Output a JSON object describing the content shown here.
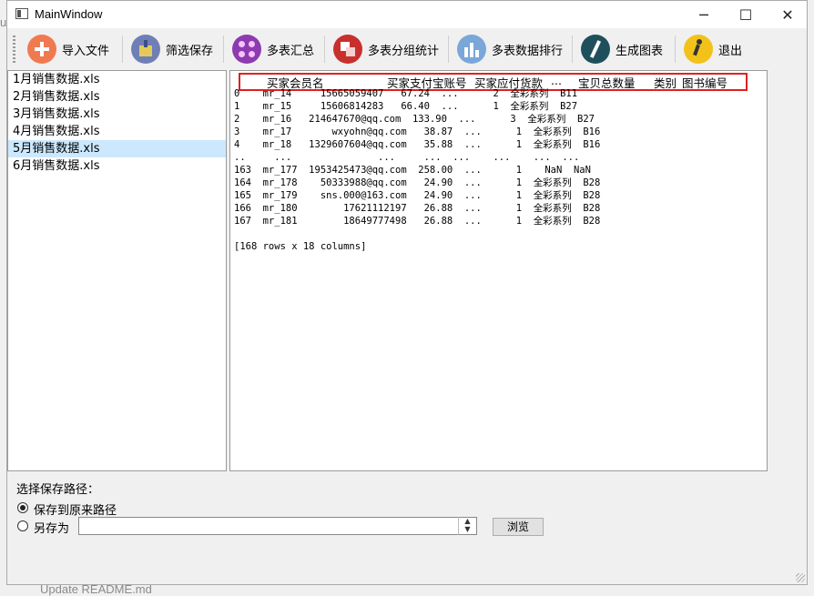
{
  "window": {
    "title": "MainWindow"
  },
  "backdrop": {
    "left_char": "u",
    "bottom_text": "Update README.md"
  },
  "toolbar": {
    "buttons": [
      {
        "label": "导入文件",
        "icon": "plus-circle-icon"
      },
      {
        "label": "筛选保存",
        "icon": "filter-save-icon"
      },
      {
        "label": "多表汇总",
        "icon": "multi-table-sum-icon"
      },
      {
        "label": "多表分组统计",
        "icon": "group-stat-icon"
      },
      {
        "label": "多表数据排行",
        "icon": "ranking-chart-icon"
      },
      {
        "label": "生成图表",
        "icon": "chart-pen-icon"
      },
      {
        "label": "退出",
        "icon": "exit-runner-icon"
      }
    ]
  },
  "file_list": {
    "items": [
      "1月销售数据.xls",
      "2月销售数据.xls",
      "3月销售数据.xls",
      "4月销售数据.xls",
      "5月销售数据.xls",
      "6月销售数据.xls"
    ],
    "selected_index": 4
  },
  "output": {
    "header": [
      "买家会员名",
      "买家支付宝账号",
      "买家应付货款",
      "...",
      "宝贝总数量",
      "类别",
      "图书编号"
    ],
    "rows": [
      "0    mr_14     15665059407   67.24  ...      2  全彩系列  B11",
      "1    mr_15     15606814283   66.40  ...      1  全彩系列  B27",
      "2    mr_16   214647670@qq.com  133.90  ...      3  全彩系列  B27",
      "3    mr_17       wxyohn@qq.com   38.87  ...      1  全彩系列  B16",
      "4    mr_18   1329607604@qq.com   35.88  ...      1  全彩系列  B16",
      "..     ...               ...     ...  ...    ...    ...  ...",
      "163  mr_177  1953425473@qq.com  258.00  ...      1    NaN  NaN",
      "164  mr_178    50333988@qq.com   24.90  ...      1  全彩系列  B28",
      "165  mr_179    sns.000@163.com   24.90  ...      1  全彩系列  B28",
      "166  mr_180        17621112197   26.88  ...      1  全彩系列  B28",
      "167  mr_181        18649777498   26.88  ...      1  全彩系列  B28"
    ],
    "summary": "[168 rows x 18 columns]"
  },
  "save": {
    "label": "选择保存路径：",
    "option_original": "保存到原来路径",
    "option_saveas": "另存为",
    "path_value": "",
    "browse_label": "浏览"
  },
  "colors": {
    "highlight": "#e02020",
    "selection": "#cce8ff"
  }
}
